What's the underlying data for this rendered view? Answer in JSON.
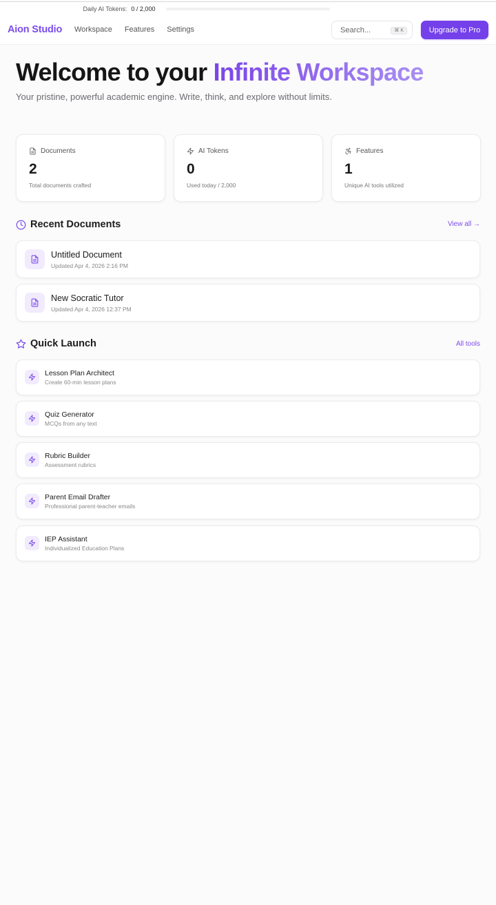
{
  "token_bar": {
    "label": "Daily AI Tokens:",
    "value": "0 / 2,000",
    "used_fraction": 0
  },
  "header": {
    "brand": "Aion Studio",
    "nav": [
      "Workspace",
      "Features",
      "Settings"
    ],
    "search_placeholder": "Search...",
    "search_shortcut": "⌘ K",
    "upgrade_label": "Upgrade to Pro"
  },
  "hero": {
    "title_prefix": "Welcome to your ",
    "title_accent": "Infinite Workspace",
    "subtitle": "Your pristine, powerful academic engine. Write, think, and explore without limits."
  },
  "stats": [
    {
      "label": "Documents",
      "value": "2",
      "desc": "Total documents crafted",
      "icon": "document-icon"
    },
    {
      "label": "AI Tokens",
      "value": "0",
      "desc": "Used today / 2,000",
      "icon": "lightning-icon"
    },
    {
      "label": "Features",
      "value": "1",
      "desc": "Unique AI tools utilized",
      "icon": "accessibility-icon"
    }
  ],
  "recent": {
    "title": "Recent Documents",
    "link": "View all →",
    "items": [
      {
        "name": "Untitled Document",
        "meta": "Updated Apr 4, 2026 2:16 PM"
      },
      {
        "name": "New Socratic Tutor",
        "meta": "Updated Apr 4, 2026 12:37 PM"
      }
    ]
  },
  "quick": {
    "title": "Quick Launch",
    "link": "All tools",
    "items": [
      {
        "name": "Lesson Plan Architect",
        "desc": "Create 60-min lesson plans"
      },
      {
        "name": "Quiz Generator",
        "desc": "MCQs from any text"
      },
      {
        "name": "Rubric Builder",
        "desc": "Assessment rubrics"
      },
      {
        "name": "Parent Email Drafter",
        "desc": "Professional parent-teacher emails"
      },
      {
        "name": "IEP Assistant",
        "desc": "Individualized Education Plans"
      }
    ]
  },
  "colors": {
    "accent": "#7440ea",
    "accent_light": "#f1ebfd",
    "brand": "#7c4dea"
  }
}
